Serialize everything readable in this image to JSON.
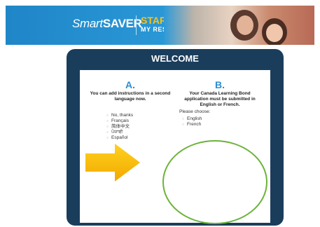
{
  "banner": {
    "brand_smart": "Smart",
    "brand_saver": "SAVER",
    "start": "START",
    "my_resp": "MY RESP"
  },
  "panel": {
    "title": "WELCOME",
    "colA": {
      "letter": "A.",
      "desc": "You can add instructions in a second language now.",
      "options": [
        "No, thanks",
        "Français",
        "简体中文",
        "ਪੰਜਾਬੀ",
        "Español"
      ]
    },
    "colB": {
      "letter": "B.",
      "desc": "Your Canada Learning Bond application must be submitted in English or French.",
      "prompt": "Please choose:",
      "options": [
        "English",
        "French"
      ]
    }
  },
  "colors": {
    "banner_blue": "#2c9ad8",
    "panel_navy": "#1a3d5c",
    "accent_yellow": "#f7c21a",
    "letter_blue": "#2b8fd0",
    "highlight_green": "#6bb33a"
  },
  "icons": {
    "next": "right-arrow-icon"
  }
}
